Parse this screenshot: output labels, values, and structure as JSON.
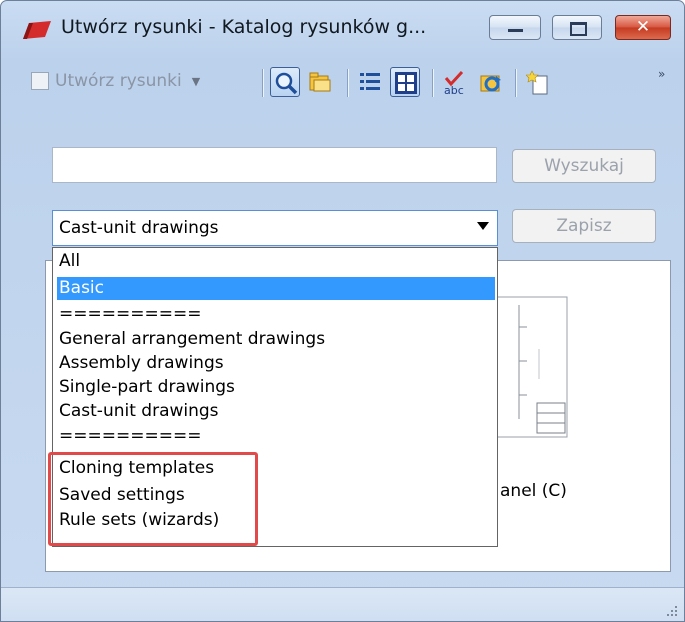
{
  "window": {
    "title": "Utwórz rysunki - Katalog rysunków g...",
    "close_glyph": "✕"
  },
  "toolbar": {
    "create_label": "Utwórz rysunki",
    "more_glyph": "»"
  },
  "search": {
    "value": "",
    "button_label": "Wyszukaj"
  },
  "filter": {
    "selected": "Cast-unit drawings",
    "save_label": "Zapisz",
    "options": [
      "All",
      "Basic",
      "==========",
      "General arrangement drawings",
      "Assembly drawings",
      "Single-part drawings",
      "Cast-unit drawings",
      "==========",
      "Cloning templates",
      "Saved settings",
      "Rule sets (wizards)"
    ],
    "highlighted_index": 1
  },
  "gallery": {
    "item_label": "anel (C)"
  },
  "colors": {
    "selection": "#3399ff",
    "annotation_box": "#e04a4a",
    "close_button": "#c43a21"
  },
  "icons": [
    "tekla-app-icon",
    "create-drawing-icon",
    "search-icon",
    "folder-icon",
    "list-view-icon",
    "thumbnail-view-icon",
    "spellcheck-icon",
    "refresh-icon",
    "new-icon",
    "overflow-chevron-icon",
    "resize-grip-icon"
  ]
}
